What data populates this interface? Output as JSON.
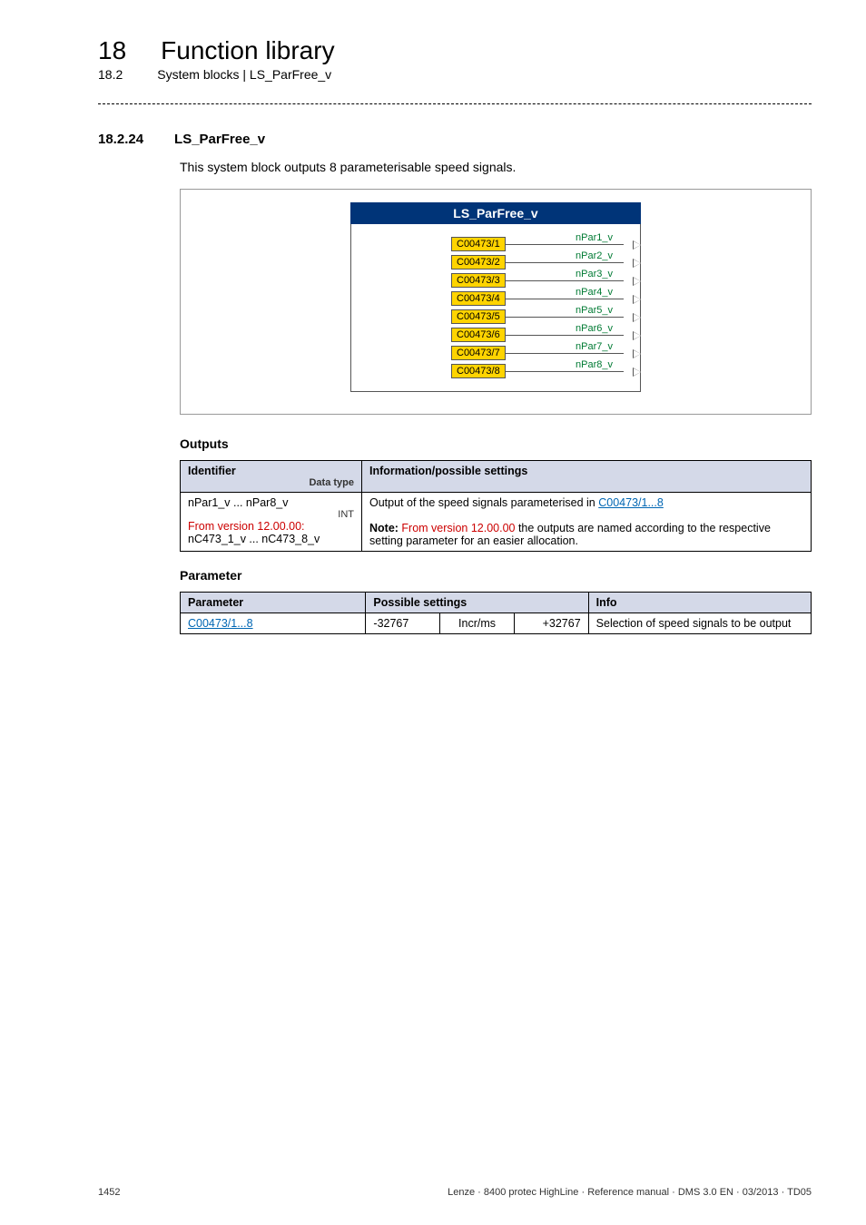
{
  "header": {
    "chapter_num": "18",
    "chapter_title": "Function library",
    "section_num": "18.2",
    "section_path": "System blocks | LS_ParFree_v"
  },
  "subsection": {
    "num": "18.2.24",
    "title": "LS_ParFree_v"
  },
  "intro_text": "This system block outputs 8 parameterisable speed signals.",
  "diagram": {
    "title": "LS_ParFree_v",
    "rows": [
      {
        "param": "C00473/1",
        "out": "nPar1_v"
      },
      {
        "param": "C00473/2",
        "out": "nPar2_v"
      },
      {
        "param": "C00473/3",
        "out": "nPar3_v"
      },
      {
        "param": "C00473/4",
        "out": "nPar4_v"
      },
      {
        "param": "C00473/5",
        "out": "nPar5_v"
      },
      {
        "param": "C00473/6",
        "out": "nPar6_v"
      },
      {
        "param": "C00473/7",
        "out": "nPar7_v"
      },
      {
        "param": "C00473/8",
        "out": "nPar8_v"
      }
    ]
  },
  "outputs_heading": "Outputs",
  "outputs_table": {
    "col_identifier": "Identifier",
    "col_info": "Information/possible settings",
    "datatype_label": "Data type",
    "row1_id_line1": "nPar1_v ... nPar8_v",
    "row1_id_int": "INT",
    "row1_id_red1": "From version 12.00.00:",
    "row1_id_line3": "nC473_1_v ... nC473_8_v",
    "row1_info_pre": "Output of the speed signals parameterised in ",
    "row1_info_link": "C00473/1...8",
    "row1_note_bold": "Note: ",
    "row1_note_red": "From version 12.00.00",
    "row1_note_tail": " the outputs are named according to the respective setting parameter for an easier allocation."
  },
  "parameter_heading": "Parameter",
  "param_table": {
    "col_param": "Parameter",
    "col_settings": "Possible settings",
    "col_info": "Info",
    "row1_param_link": "C00473/1...8",
    "row1_min": "-32767",
    "row1_unit": "Incr/ms",
    "row1_max": "+32767",
    "row1_info": "Selection of speed signals to be output"
  },
  "footer": {
    "page": "1452",
    "right": "Lenze · 8400 protec HighLine · Reference manual · DMS 3.0 EN · 03/2013 · TD05"
  }
}
